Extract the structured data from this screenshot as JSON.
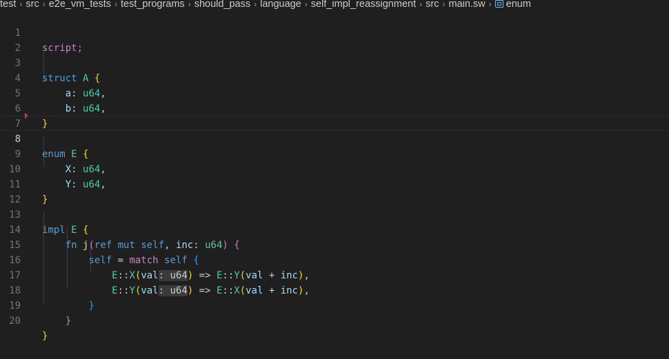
{
  "breadcrumb": {
    "items": [
      "test",
      "src",
      "e2e_vm_tests",
      "test_programs",
      "should_pass",
      "language",
      "self_impl_reassignment",
      "src",
      "main.sw",
      "enum"
    ],
    "separator": "›"
  },
  "editor": {
    "active_line": 8,
    "line_numbers": [
      "1",
      "2",
      "3",
      "4",
      "5",
      "6",
      "7",
      "8",
      "9",
      "10",
      "11",
      "12",
      "13",
      "14",
      "15",
      "16",
      "17",
      "18",
      "19",
      "20"
    ],
    "lines": [
      "script;",
      "",
      "struct A {",
      "    a: u64,",
      "    b: u64,",
      "}",
      "",
      "enum E {",
      "    X: u64,",
      "    Y: u64,",
      "}",
      "",
      "impl E {",
      "    fn j(ref mut self, inc: u64) {",
      "        self = match self {",
      "            E::X(val: u64) => E::Y(val + inc),",
      "            E::Y(val: u64) => E::X(val + inc),",
      "        }",
      "    }",
      "}"
    ]
  },
  "colors": {
    "background": "#1f1f1f",
    "keyword": "#569cd6",
    "control_keyword": "#c586c0",
    "type": "#4ec9b0",
    "function": "#dcdcaa",
    "variable": "#9cdcfe",
    "bracket_level1": "#ffd700",
    "bracket_level2": "#da70d6",
    "bracket_level3": "#179fff"
  }
}
